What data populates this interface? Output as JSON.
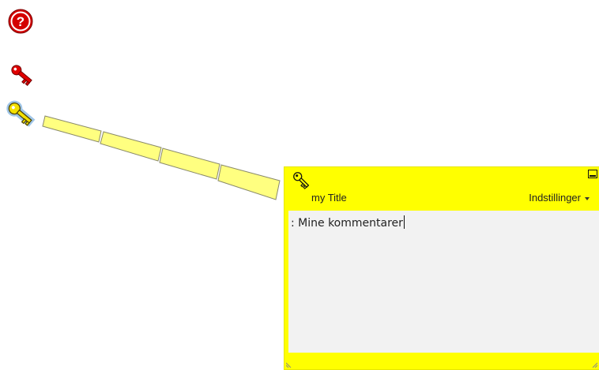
{
  "toolbar": {
    "help_icon": "question-mark-icon",
    "note_tool_icon": "red-key-icon",
    "selected_note_icon": "yellow-key-icon"
  },
  "note": {
    "title": "my Title",
    "settings_label": "Indstillinger",
    "comment_text": ": Mine kommentarer",
    "colors": {
      "note_background": "#ffff00",
      "comment_background": "#f2f2f2",
      "connector_fill": "#ffff80",
      "key_yellow": "#f4e000",
      "key_red": "#e00000",
      "help_red": "#d40000"
    }
  }
}
